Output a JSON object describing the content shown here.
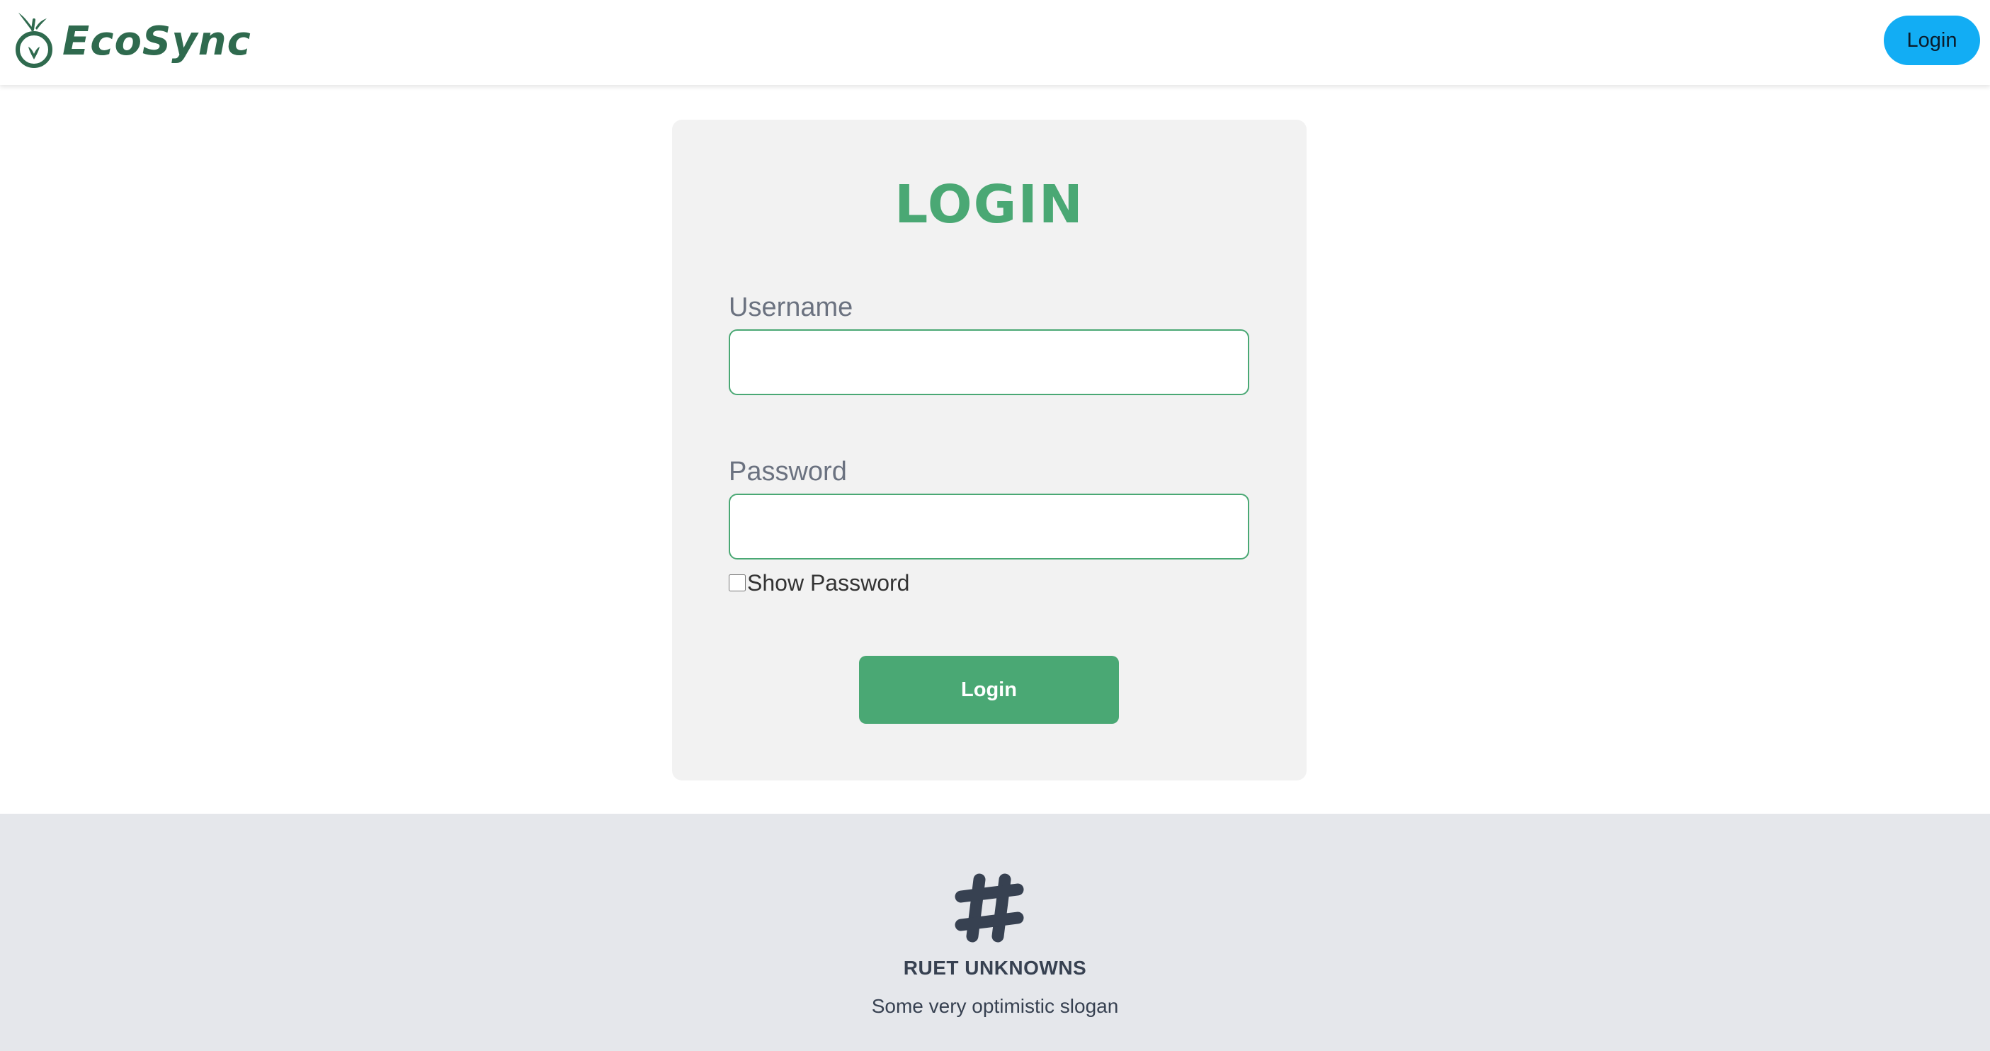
{
  "header": {
    "brand": "EcoSync",
    "logo_icon": "apple-leaf-icon",
    "login_button": "Login",
    "colors": {
      "brand": "#2f6a4e",
      "login_button_bg": "#12adf4"
    }
  },
  "login_form": {
    "title": "LOGIN",
    "username_label": "Username",
    "username_value": "",
    "password_label": "Password",
    "password_value": "",
    "show_password_label": "Show Password",
    "show_password_checked": false,
    "submit_label": "Login",
    "colors": {
      "accent": "#4aa874",
      "card_bg": "#f2f2f2",
      "label": "#6b7280"
    }
  },
  "footer": {
    "icon": "slack-hash-icon",
    "brand": "RUET UNKNOWNS",
    "slogan": "Some very optimistic slogan",
    "colors": {
      "background": "#e5e7eb",
      "text": "#374151"
    }
  }
}
